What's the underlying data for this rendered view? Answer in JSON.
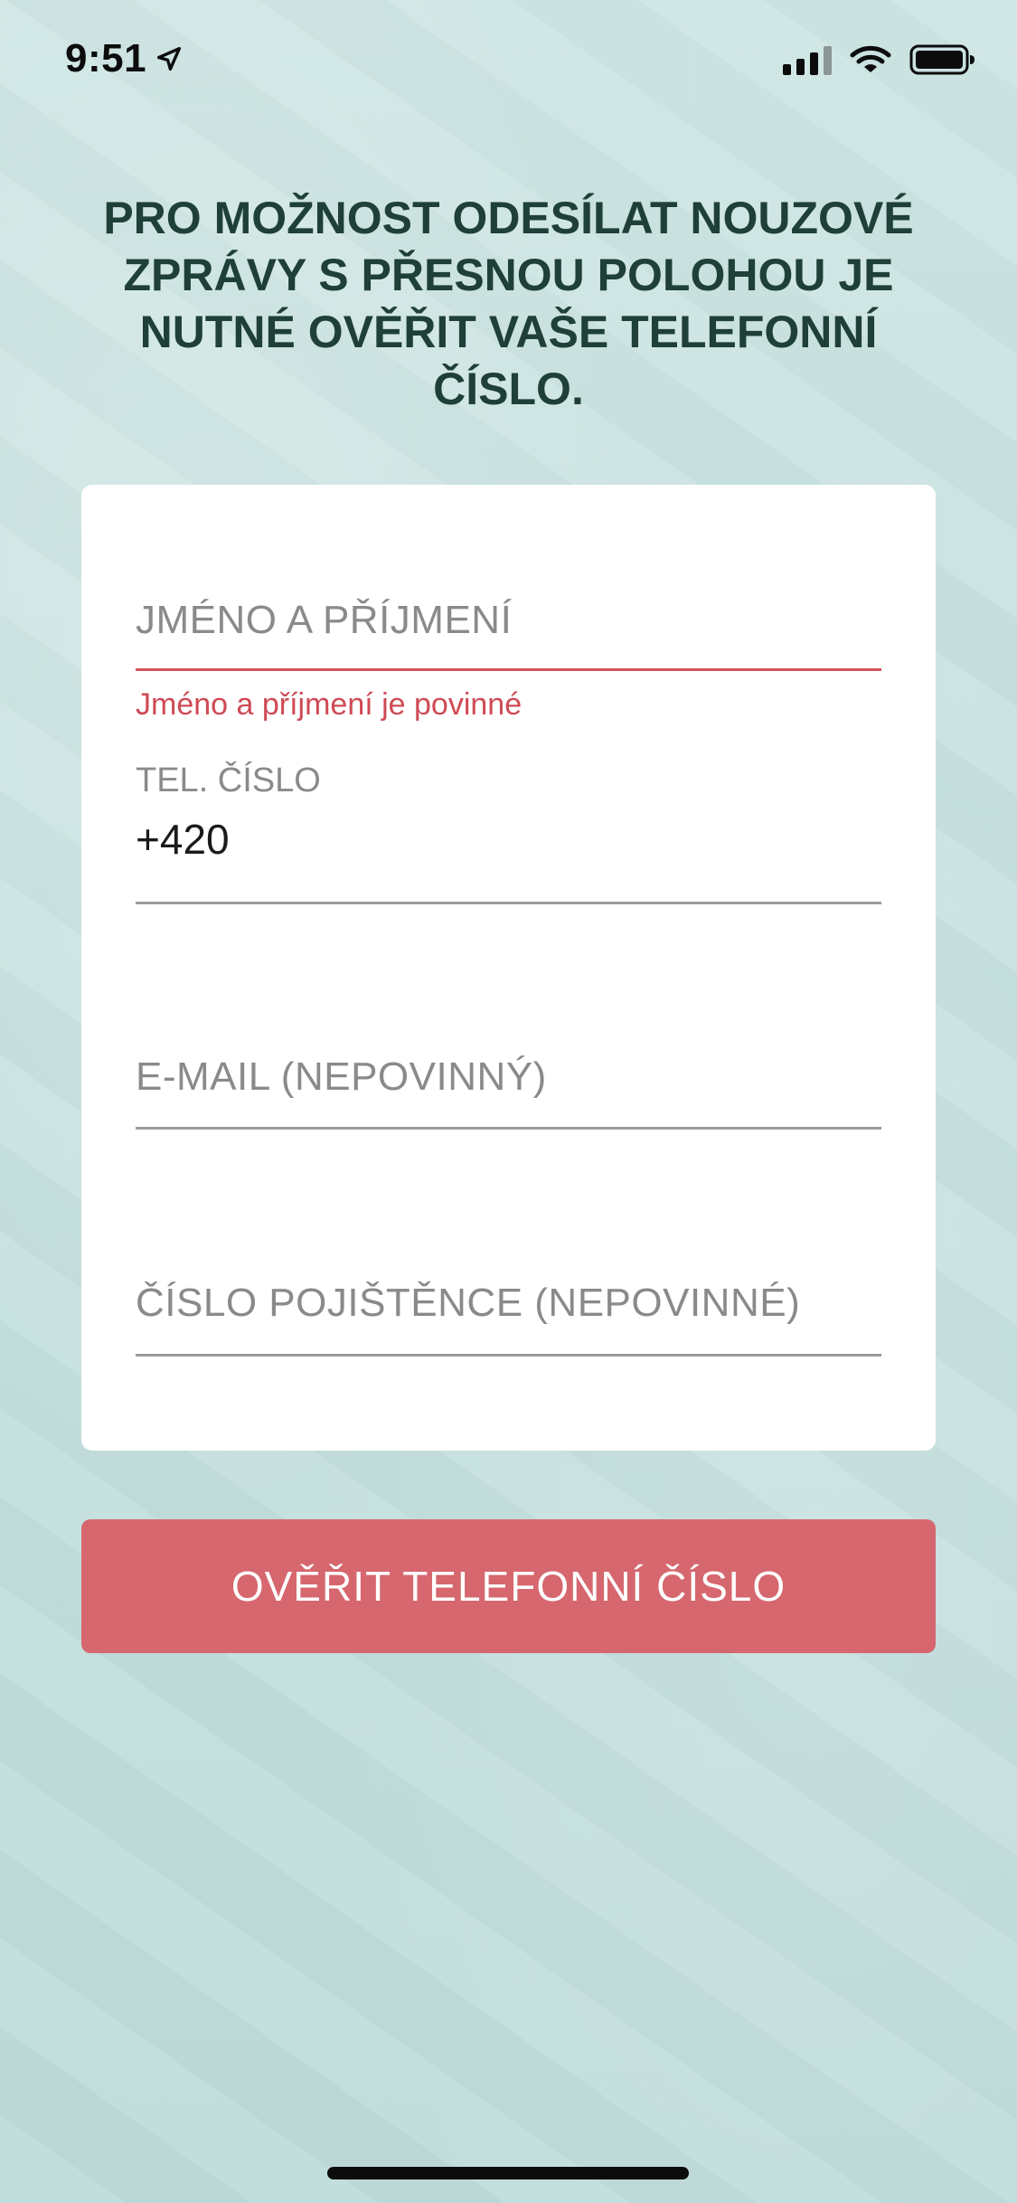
{
  "status_bar": {
    "time": "9:51"
  },
  "heading": "PRO MOŽNOST ODESÍLAT NOUZOVÉ ZPRÁVY S PŘESNOU POLOHOU JE NUTNÉ OVĚŘIT VAŠE TELEFONNÍ ČÍSLO.",
  "form": {
    "name_field": {
      "placeholder": "JMÉNO A PŘÍJMENÍ",
      "value": "",
      "error": "Jméno a příjmení je povinné"
    },
    "phone_field": {
      "label": "TEL. ČÍSLO",
      "value": "+420"
    },
    "email_field": {
      "placeholder": "E-MAIL (NEPOVINNÝ)",
      "value": ""
    },
    "insurance_field": {
      "placeholder": "ČÍSLO POJIŠTĚNCE (NEPOVINNÉ)",
      "value": ""
    }
  },
  "verify_button": {
    "label": "OVĚŘIT TELEFONNÍ ČÍSLO"
  },
  "colors": {
    "background": "#c6e1df",
    "heading": "#1f3f39",
    "card": "#ffffff",
    "error": "#cf4a55",
    "button": "#d6676f",
    "placeholder": "#8a8a8a"
  },
  "icons": [
    "location-arrow-icon",
    "signal-icon",
    "wifi-icon",
    "battery-icon"
  ]
}
